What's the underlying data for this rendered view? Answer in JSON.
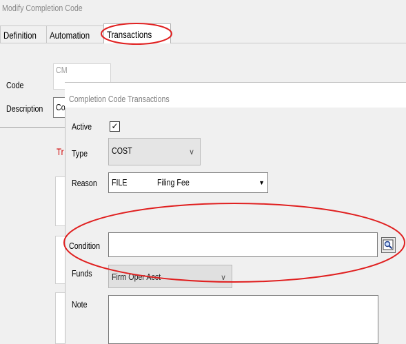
{
  "window": {
    "title": "Modify Completion Code"
  },
  "tabs": [
    {
      "label": "Definition"
    },
    {
      "label": "Automation"
    },
    {
      "label": "Transactions"
    }
  ],
  "form": {
    "code_label": "Code",
    "code_value": "CM",
    "description_label": "Description",
    "description_value": "Co",
    "section_heading_partial": "Tr"
  },
  "dialog": {
    "title": "Completion Code Transactions",
    "active": {
      "label": "Active",
      "checked": true,
      "mark": "✓"
    },
    "type": {
      "label": "Type",
      "value": "COST"
    },
    "reason": {
      "label": "Reason",
      "code": "FILE",
      "description": "Filing Fee"
    },
    "condition": {
      "label": "Condition",
      "value": "",
      "lookup_icon": "lookup-icon"
    },
    "funds": {
      "label": "Funds",
      "value": "Firm Oper Acct"
    },
    "note": {
      "label": "Note",
      "value": ""
    }
  },
  "annotations": {
    "color": "#e02020"
  }
}
